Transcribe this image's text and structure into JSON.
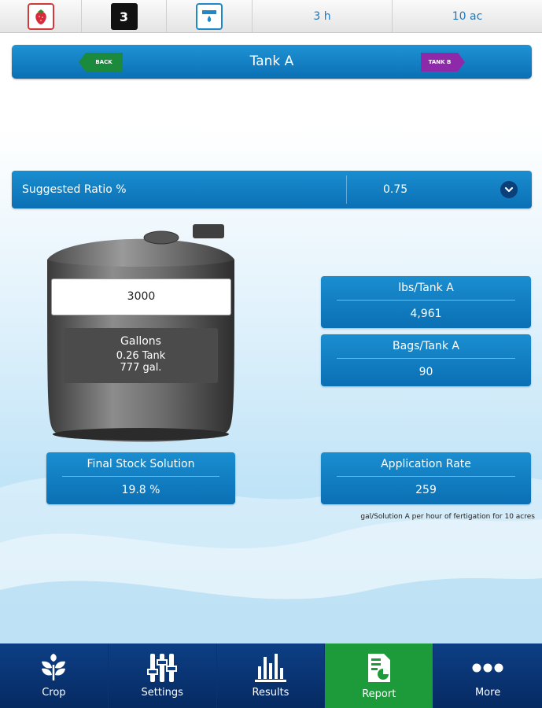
{
  "topbar": {
    "crop_icon": "strawberry-icon",
    "stage_icon": "stage-3-icon",
    "stage_digit": "3",
    "tank_icon": "tank-drop-icon",
    "hours": "3 h",
    "area": "10 ac"
  },
  "header": {
    "title": "Tank A",
    "back_label": "BACK",
    "next_label": "TANK B"
  },
  "ratio": {
    "label": "Suggested Ratio %",
    "value": "0.75"
  },
  "tank": {
    "input_value": "3000",
    "unit_label": "Gallons",
    "tank_fraction": "0.26 Tank",
    "gallons": "777 gal."
  },
  "boxes": {
    "lbs": {
      "title": "lbs/Tank A",
      "value": "4,961"
    },
    "bags": {
      "title": "Bags/Tank A",
      "value": "90"
    },
    "stock": {
      "title": "Final Stock Solution",
      "value": "19.8 %"
    },
    "application": {
      "title": "Application Rate",
      "value": "259"
    }
  },
  "footnote": "gal/Solution A per hour of fertigation for 10 acres",
  "bottomnav": {
    "crop": "Crop",
    "settings": "Settings",
    "results": "Results",
    "report": "Report",
    "more": "More"
  },
  "colors": {
    "primary_blue": "#0b6fb4",
    "nav_dark": "#062a62",
    "active_green": "#1d9a3a",
    "back_green": "#1b8a3c",
    "next_purple": "#8e2aa9"
  }
}
